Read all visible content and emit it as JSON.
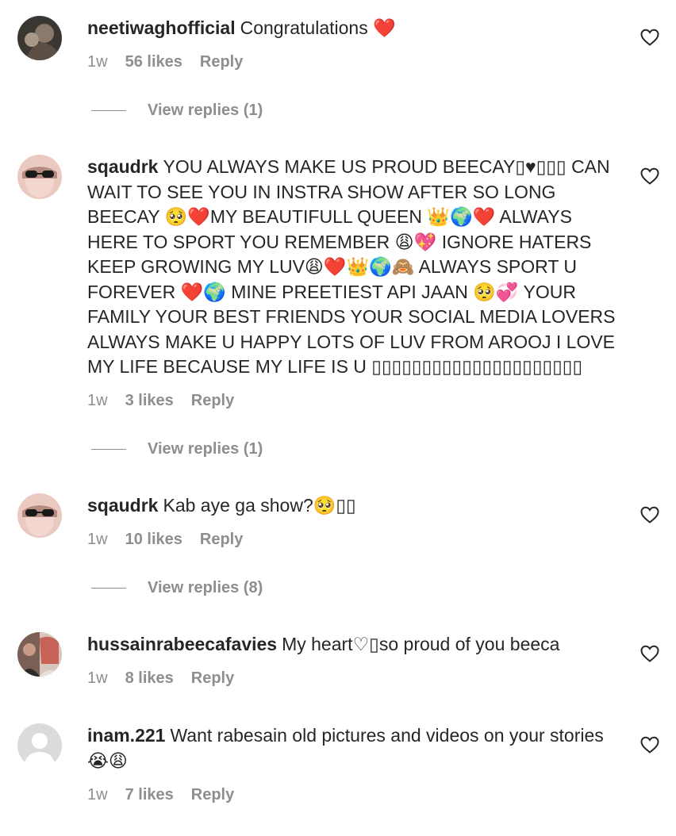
{
  "comments": [
    {
      "username": "neetiwaghofficial",
      "text": "Congratulations ❤️",
      "time": "1w",
      "likes": "56 likes",
      "reply": "Reply",
      "view_replies": "View replies (1)"
    },
    {
      "username": "sqaudrk",
      "text": "YOU ALWAYS MAKE US PROUD BEECAY▯♥▯▯▯ CAN WAIT TO SEE YOU IN INSTRA SHOW AFTER SO LONG BEECAY 🥺❤️MY BEAUTIFULL QUEEN 👑🌍❤️ ALWAYS HERE TO SPORT YOU REMEMBER 😩💖 IGNORE HATERS KEEP GROWING MY LUV😩❤️👑🌍🙈 ALWAYS SPORT U FOREVER ❤️🌍 MINE PREETIEST API JAAN 🥺💞 YOUR FAMILY YOUR BEST FRIENDS YOUR SOCIAL MEDIA LOVERS ALWAYS MAKE U HAPPY LOTS OF LUV FROM AROOJ I LOVE MY LIFE BECAUSE MY LIFE IS U ▯▯▯▯▯▯▯▯▯▯▯▯▯▯▯▯▯▯▯▯▯",
      "time": "1w",
      "likes": "3 likes",
      "reply": "Reply",
      "view_replies": "View replies (1)"
    },
    {
      "username": "sqaudrk",
      "text": "Kab aye ga show?🥺▯▯",
      "time": "1w",
      "likes": "10 likes",
      "reply": "Reply",
      "view_replies": "View replies (8)"
    },
    {
      "username": "hussainrabeecafavies",
      "text": "My heart♡▯so proud of you beeca",
      "time": "1w",
      "likes": "8 likes",
      "reply": "Reply"
    },
    {
      "username": "inam.221",
      "text": "Want rabesain old pictures and videos on your stories 😭😩",
      "time": "1w",
      "likes": "7 likes",
      "reply": "Reply"
    }
  ],
  "icons": {
    "like": "heart-outline-icon",
    "avatar_default": "default-avatar-icon"
  },
  "colors": {
    "text": "#262626",
    "muted": "#8e8e8e",
    "heart": "#e0245e"
  }
}
